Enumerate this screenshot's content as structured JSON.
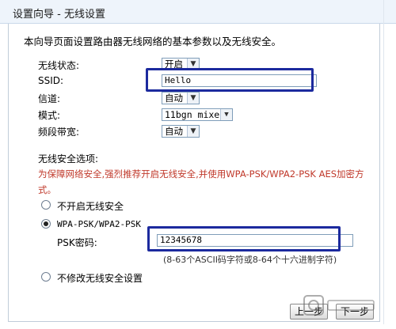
{
  "window": {
    "title": "设置向导 - 无线设置"
  },
  "intro": "本向导页面设置路由器无线网络的基本参数以及无线安全。",
  "fields": {
    "wireless_status": {
      "label": "无线状态:",
      "value": "开启"
    },
    "ssid": {
      "label": "SSID:",
      "value": "Hello"
    },
    "channel": {
      "label": "信道:",
      "value": "自动"
    },
    "mode": {
      "label": "模式:",
      "value": "11bgn mixed"
    },
    "bandwidth": {
      "label": "频段带宽:",
      "value": "自动"
    }
  },
  "security": {
    "heading": "无线安全选项:",
    "warning_line1": "为保障网络安全,强烈推荐开启无线安全,并使用WPA-PSK/WPA2-PSK AES加密方",
    "warning_line2": "式。",
    "options": {
      "disable": "不开启无线安全",
      "wpa": "WPA-PSK/WPA2-PSK",
      "keep": "不修改无线安全设置"
    },
    "psk_label": "PSK密码:",
    "psk_value": "12345678",
    "psk_hint": "(8-63个ASCII码字符或8-64个十六进制字符)"
  },
  "buttons": {
    "prev": "上一步",
    "next": "下一步"
  },
  "colors": {
    "highlight": "#1c2a9e",
    "warning": "#c0392b",
    "title_bg": "#eef4fb"
  }
}
